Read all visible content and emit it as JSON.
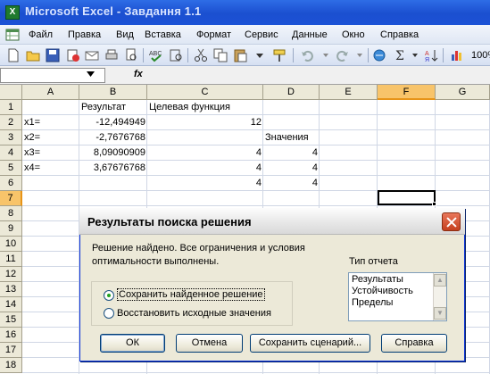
{
  "window": {
    "title": "Microsoft Excel - Завдання 1.1"
  },
  "menu": {
    "items": [
      "Файл",
      "Правка",
      "Вид",
      "Вставка",
      "Формат",
      "Сервис",
      "Данные",
      "Окно",
      "Справка"
    ]
  },
  "toolbar": {
    "zoom": "100%"
  },
  "formula_bar": {
    "name_box": "",
    "fx": "fx",
    "formula": ""
  },
  "grid": {
    "columns": [
      "A",
      "B",
      "C",
      "D",
      "E",
      "F",
      "G"
    ],
    "rows": [
      "1",
      "2",
      "3",
      "4",
      "5",
      "6",
      "7",
      "8",
      "9",
      "10",
      "11",
      "12",
      "13",
      "14",
      "15",
      "16",
      "17",
      "18"
    ],
    "active_column": "F",
    "active_row": "7",
    "cells": {
      "B1": "Результат",
      "C1": "Целевая функция",
      "A2": "x1=",
      "B2": "-12,494949",
      "C2": "12",
      "A3": "x2=",
      "B3": "-2,7676768",
      "D3": "Значения",
      "A4": "x3=",
      "B4": "8,09090909",
      "C4": "4",
      "D4": "4",
      "A5": "x4=",
      "B5": "3,67676768",
      "C5": "4",
      "D5": "4",
      "C6": "4",
      "D6": "4"
    }
  },
  "dialog": {
    "title": "Результаты поиска решения",
    "message_line1": "Решение найдено. Все ограничения и условия",
    "message_line2": "оптимальности выполнены.",
    "report_type_label": "Тип отчета",
    "report_types": [
      "Результаты",
      "Устойчивость",
      "Пределы"
    ],
    "option_keep": "Сохранить найденное решение",
    "option_restore": "Восстановить исходные значения",
    "selected_option": "keep",
    "buttons": {
      "ok": "ОК",
      "cancel": "Отмена",
      "save_scenario": "Сохранить сценарий...",
      "help": "Справка"
    }
  }
}
